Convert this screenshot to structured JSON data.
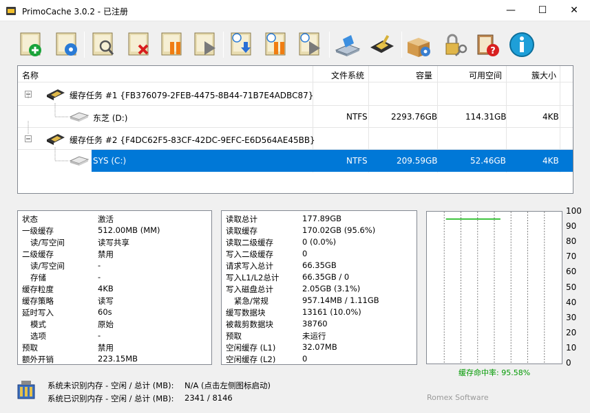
{
  "window": {
    "title": "PrimoCache 3.0.2 - 已注册"
  },
  "toolbar": {
    "buttons": [
      "create-cache-button",
      "configure-cache-button",
      "view-statistics-button",
      "delete-cache-button",
      "pause-cache-button",
      "resume-cache-button",
      "load-settings-button",
      "pause-all-button",
      "resume-all-button",
      "options-button",
      "l2-storage-button",
      "tools-button",
      "license-button",
      "help-button",
      "about-button"
    ]
  },
  "tree": {
    "headers": {
      "name": "名称",
      "fs": "文件系统",
      "capacity": "容量",
      "free": "可用空间",
      "cluster": "簇大小"
    },
    "rows": [
      {
        "type": "task",
        "label": "缓存任务 #1 {FB376079-2FEB-4475-8B44-71B7E4ADBC87}"
      },
      {
        "type": "volume",
        "label": "东芝 (D:)",
        "fs": "NTFS",
        "capacity": "2293.76GB",
        "free": "114.31GB",
        "cluster": "4KB"
      },
      {
        "type": "task",
        "label": "缓存任务 #2 {F4DC62F5-83CF-42DC-9EFC-E6D564AE45BB}"
      },
      {
        "type": "volume",
        "label": "SYS (C:)",
        "fs": "NTFS",
        "capacity": "209.59GB",
        "free": "52.46GB",
        "cluster": "4KB",
        "selected": true
      }
    ]
  },
  "left_panel": [
    {
      "label": "状态",
      "value": "激活"
    },
    {
      "label": "一级缓存",
      "value": "512.00MB (MM)"
    },
    {
      "label": "读/写空间",
      "value": "读写共享",
      "indent": true
    },
    {
      "label": "二级缓存",
      "value": "禁用"
    },
    {
      "label": "读/写空间",
      "value": "-",
      "indent": true
    },
    {
      "label": "存储",
      "value": "-",
      "indent": true
    },
    {
      "label": "缓存粒度",
      "value": "4KB"
    },
    {
      "label": "缓存策略",
      "value": "读写"
    },
    {
      "label": "延时写入",
      "value": "60s"
    },
    {
      "label": "模式",
      "value": "原始",
      "indent": true
    },
    {
      "label": "选项",
      "value": "-",
      "indent": true
    },
    {
      "label": "预取",
      "value": "禁用"
    },
    {
      "label": "额外开销",
      "value": "223.15MB"
    }
  ],
  "mid_panel": [
    {
      "label": "读取总计",
      "value": "177.89GB"
    },
    {
      "label": "读取缓存",
      "value": "170.02GB (95.6%)"
    },
    {
      "label": "读取二级缓存",
      "value": "0 (0.0%)"
    },
    {
      "label": "写入二级缓存",
      "value": "0"
    },
    {
      "label": "请求写入总计",
      "value": "66.35GB"
    },
    {
      "label": "写入L1/L2总计",
      "value": "66.35GB / 0"
    },
    {
      "label": "写入磁盘总计",
      "value": "2.05GB (3.1%)"
    },
    {
      "label": "紧急/常规",
      "value": "957.14MB / 1.11GB",
      "indent": true
    },
    {
      "label": "缓写数据块",
      "value": "13161 (10.0%)"
    },
    {
      "label": "被裁剪数据块",
      "value": "38760"
    },
    {
      "label": "预取",
      "value": "未运行"
    },
    {
      "label": "空闲缓存 (L1)",
      "value": "32.07MB"
    },
    {
      "label": "空闲缓存 (L2)",
      "value": "0"
    }
  ],
  "chart_data": {
    "type": "line",
    "yticks": [
      "100",
      "90",
      "80",
      "70",
      "60",
      "50",
      "40",
      "30",
      "20",
      "10",
      "0"
    ],
    "ylim": [
      0,
      100
    ],
    "series": [
      {
        "values": [
          95.58,
          95.58,
          95.58,
          95.58
        ]
      }
    ],
    "grid": true,
    "color": "#00b000"
  },
  "hit_rate": {
    "label": "缓存命中率: 95.58%"
  },
  "bottom": {
    "line1_label": "系统未识别内存 - 空闲 / 总计 (MB):",
    "line1_value": "N/A (点击左侧图标启动)",
    "line2_label": "系统已识别内存 - 空闲 / 总计 (MB):",
    "line2_value": "2341 / 8146",
    "brand": "Romex Software"
  },
  "colors": {
    "selection": "#0078d7",
    "hit_rate": "#009900"
  }
}
